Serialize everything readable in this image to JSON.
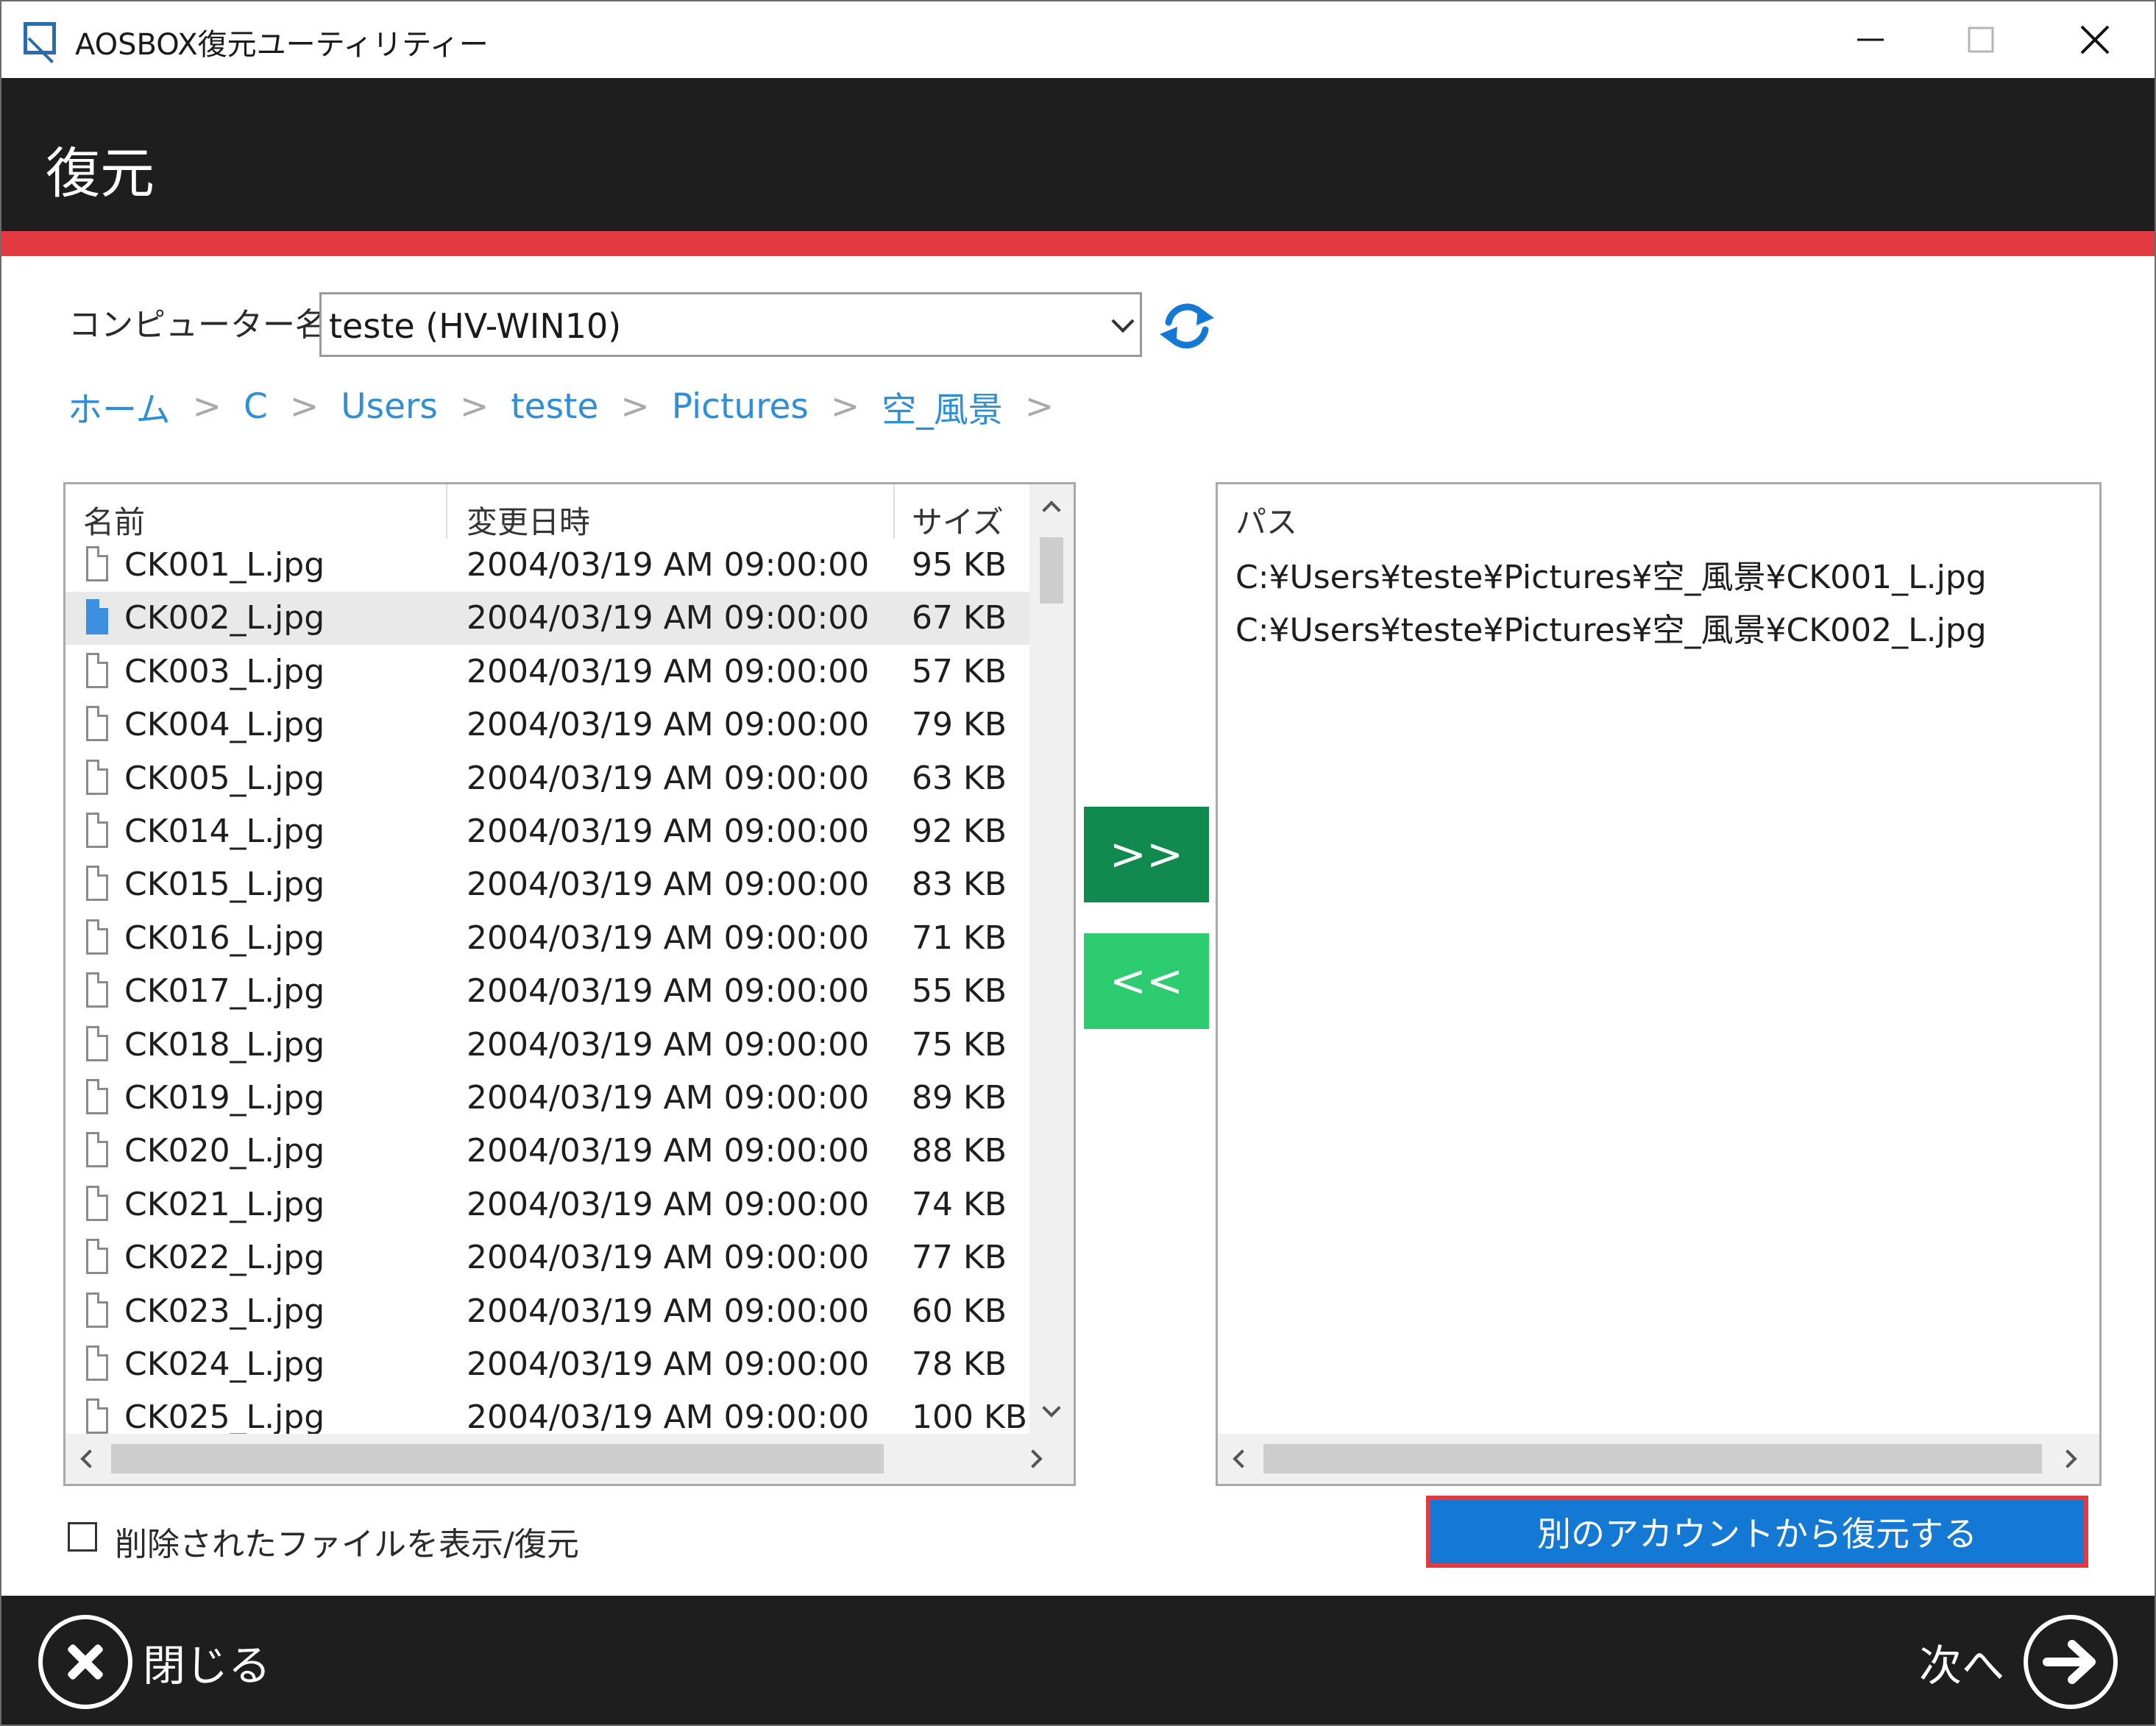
{
  "window": {
    "title": "AOSBOX復元ユーティリティー"
  },
  "header": {
    "title": "復元"
  },
  "computer": {
    "label": "コンピューター名:",
    "value": "teste (HV-WIN10)"
  },
  "breadcrumb": [
    "ホーム",
    "C",
    "Users",
    "teste",
    "Pictures",
    "空_風景"
  ],
  "filelist": {
    "columns": [
      "名前",
      "変更日時",
      "サイズ"
    ],
    "rows": [
      {
        "name": "CK001_L.jpg",
        "date": "2004/03/19 AM 09:00:00",
        "size": "95 KB"
      },
      {
        "name": "CK002_L.jpg",
        "date": "2004/03/19 AM 09:00:00",
        "size": "67 KB",
        "selected": true
      },
      {
        "name": "CK003_L.jpg",
        "date": "2004/03/19 AM 09:00:00",
        "size": "57 KB"
      },
      {
        "name": "CK004_L.jpg",
        "date": "2004/03/19 AM 09:00:00",
        "size": "79 KB"
      },
      {
        "name": "CK005_L.jpg",
        "date": "2004/03/19 AM 09:00:00",
        "size": "63 KB"
      },
      {
        "name": "CK014_L.jpg",
        "date": "2004/03/19 AM 09:00:00",
        "size": "92 KB"
      },
      {
        "name": "CK015_L.jpg",
        "date": "2004/03/19 AM 09:00:00",
        "size": "83 KB"
      },
      {
        "name": "CK016_L.jpg",
        "date": "2004/03/19 AM 09:00:00",
        "size": "71 KB"
      },
      {
        "name": "CK017_L.jpg",
        "date": "2004/03/19 AM 09:00:00",
        "size": "55 KB"
      },
      {
        "name": "CK018_L.jpg",
        "date": "2004/03/19 AM 09:00:00",
        "size": "75 KB"
      },
      {
        "name": "CK019_L.jpg",
        "date": "2004/03/19 AM 09:00:00",
        "size": "89 KB"
      },
      {
        "name": "CK020_L.jpg",
        "date": "2004/03/19 AM 09:00:00",
        "size": "88 KB"
      },
      {
        "name": "CK021_L.jpg",
        "date": "2004/03/19 AM 09:00:00",
        "size": "74 KB"
      },
      {
        "name": "CK022_L.jpg",
        "date": "2004/03/19 AM 09:00:00",
        "size": "77 KB"
      },
      {
        "name": "CK023_L.jpg",
        "date": "2004/03/19 AM 09:00:00",
        "size": "60 KB"
      },
      {
        "name": "CK024_L.jpg",
        "date": "2004/03/19 AM 09:00:00",
        "size": "78 KB"
      },
      {
        "name": "CK025_L.jpg",
        "date": "2004/03/19 AM 09:00:00",
        "size": "100 KB"
      }
    ]
  },
  "transfer": {
    "add_label": ">>",
    "remove_label": "<<"
  },
  "pathlist": {
    "header": "パス",
    "paths": [
      "C:¥Users¥teste¥Pictures¥空_風景¥CK001_L.jpg",
      "C:¥Users¥teste¥Pictures¥空_風景¥CK002_L.jpg"
    ]
  },
  "options": {
    "show_deleted_label": "削除されたファイルを表示/復元",
    "show_deleted_checked": false
  },
  "alt_account_button": "別のアカウントから復元する",
  "footer": {
    "close_label": "閉じる",
    "next_label": "次へ"
  },
  "colors": {
    "header_bg": "#1e1e1e",
    "accent_red": "#e33a41",
    "link_blue": "#2f8fd6",
    "add_green": "#108a4e",
    "remove_green": "#2ecc71",
    "alt_button_blue": "#1479d4"
  }
}
